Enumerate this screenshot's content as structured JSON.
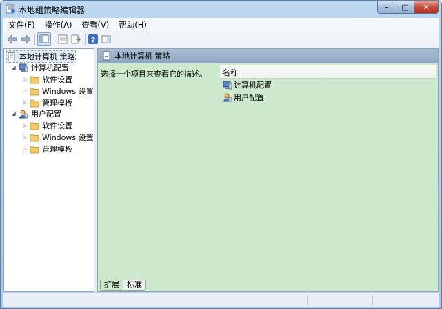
{
  "window": {
    "title": "本地组策略编辑器"
  },
  "caption": {
    "minimize": "–",
    "maximize": "□",
    "close": "✕"
  },
  "menu": [
    "文件(F)",
    "操作(A)",
    "查看(V)",
    "帮助(H)"
  ],
  "toolbar": {
    "buttons": [
      "back-arrow-icon",
      "forward-arrow-icon",
      "show-hide-tree-icon",
      "properties-icon",
      "export-list-icon",
      "help-icon",
      "show-hide-action-pane-icon"
    ]
  },
  "tree": {
    "root": "本地计算机 策略",
    "computer": {
      "label": "计算机配置",
      "children": [
        "软件设置",
        "Windows 设置",
        "管理模板"
      ]
    },
    "user": {
      "label": "用户配置",
      "children": [
        "软件设置",
        "Windows 设置",
        "管理模板"
      ]
    }
  },
  "content": {
    "header": "本地计算机 策略",
    "description": "选择一个项目来查看它的描述。",
    "column_name": "名称",
    "items": [
      "计算机配置",
      "用户配置"
    ]
  },
  "tabs": [
    "扩展",
    "标准"
  ],
  "colors": {
    "content_bg": "#cde8cc",
    "selection": "#e3eefb"
  }
}
